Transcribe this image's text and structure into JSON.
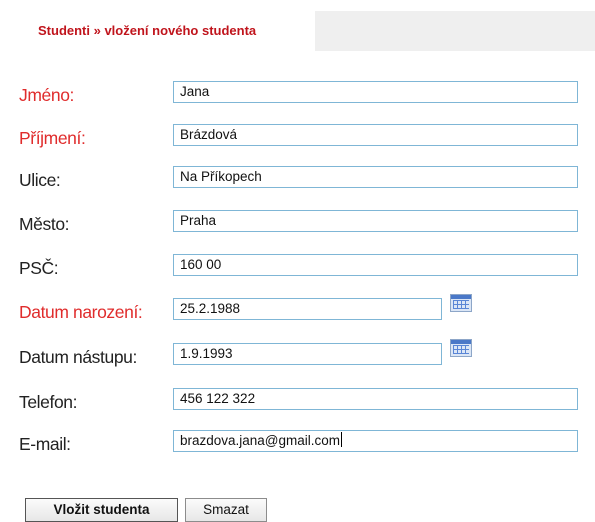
{
  "header": {
    "tab_title": "Studenti » vložení nového studenta"
  },
  "form": {
    "fields": [
      {
        "label": "Jméno:",
        "value": "Jana",
        "required": true
      },
      {
        "label": "Příjmení:",
        "value": "Brázdová",
        "required": true
      },
      {
        "label": "Ulice:",
        "value": "Na Příkopech",
        "required": false
      },
      {
        "label": "Město:",
        "value": "Praha",
        "required": false
      },
      {
        "label": "PSČ:",
        "value": "160 00",
        "required": false
      },
      {
        "label": "Datum narození:",
        "value": "25.2.1988",
        "required": true
      },
      {
        "label": "Datum nástupu:",
        "value": "1.9.1993",
        "required": false
      },
      {
        "label": "Telefon:",
        "value": "456 122 322",
        "required": false
      },
      {
        "label": "E-mail:",
        "value": "brazdova.jana@gmail.com",
        "required": false
      }
    ]
  },
  "buttons": {
    "submit_label": "Vložit studenta",
    "reset_label": "Smazat"
  },
  "icons": {
    "calendar": "calendar-icon"
  },
  "colors": {
    "required_label": "#e02c2c",
    "tab_title": "#c0141c",
    "input_border": "#7fb6d6"
  }
}
